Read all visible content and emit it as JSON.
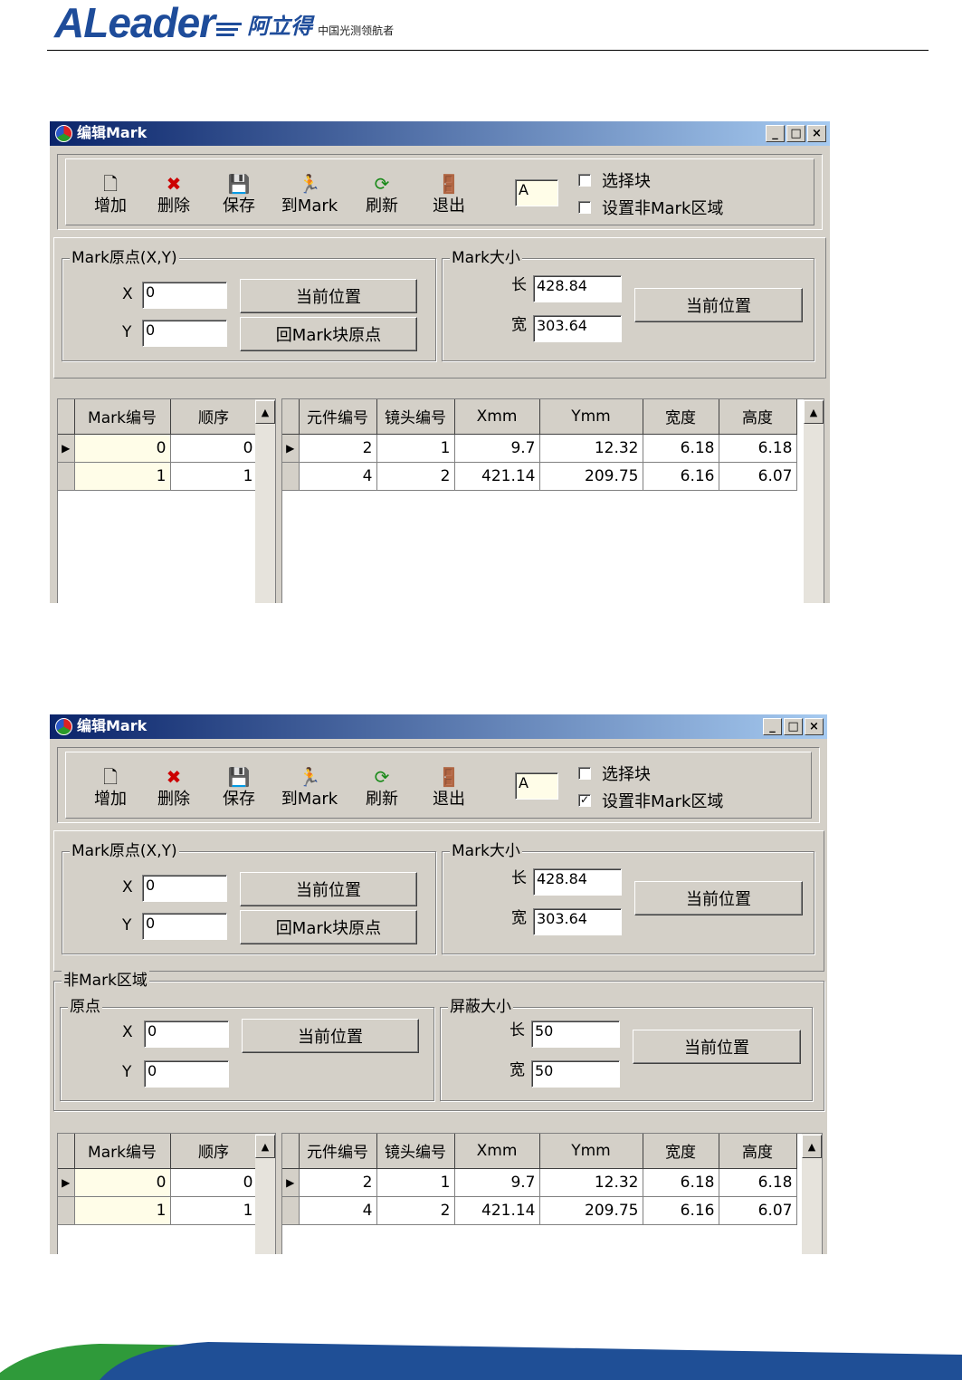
{
  "header": {
    "logo_text": "ALeader",
    "logo_cn": "阿立得",
    "slogan": "中国光测领航者"
  },
  "windows": [
    {
      "title": "编辑Mark",
      "title_buttons": [
        "_",
        "□",
        "×"
      ],
      "toolbar": {
        "tools": [
          {
            "label": "增加",
            "icon": "new-doc-icon"
          },
          {
            "label": "删除",
            "icon": "delete-icon"
          },
          {
            "label": "保存",
            "icon": "save-icon"
          },
          {
            "label": "到Mark",
            "icon": "run-man-icon"
          },
          {
            "label": "刷新",
            "icon": "refresh-icon"
          },
          {
            "label": "退出",
            "icon": "exit-door-icon"
          }
        ],
        "block_value": "A",
        "select_block": {
          "label": "选择块",
          "checked": false
        },
        "set_non_mark": {
          "label": "设置非Mark区域",
          "checked": false
        }
      },
      "mark_origin": {
        "title": "Mark原点(X,Y)",
        "x_label": "X",
        "x_value": "0",
        "y_label": "Y",
        "y_value": "0",
        "current_btn": "当前位置",
        "return_btn": "回Mark块原点"
      },
      "mark_size": {
        "title": "Mark大小",
        "len_label": "长",
        "len_value": "428.84",
        "wid_label": "宽",
        "wid_value": "303.64",
        "current_btn": "当前位置"
      },
      "mark_table": {
        "headers": [
          "Mark编号",
          "顺序"
        ],
        "rows": [
          [
            "0",
            "0"
          ],
          [
            "1",
            "1"
          ]
        ]
      },
      "part_table": {
        "headers": [
          "元件编号",
          "镜头编号",
          "Xmm",
          "Ymm",
          "宽度",
          "高度"
        ],
        "rows": [
          [
            "2",
            "1",
            "9.7",
            "12.32",
            "6.18",
            "6.18"
          ],
          [
            "4",
            "2",
            "421.14",
            "209.75",
            "6.16",
            "6.07"
          ]
        ]
      }
    },
    {
      "title": "编辑Mark",
      "title_buttons": [
        "_",
        "□",
        "×"
      ],
      "toolbar": {
        "tools": [
          {
            "label": "增加",
            "icon": "new-doc-icon"
          },
          {
            "label": "删除",
            "icon": "delete-icon"
          },
          {
            "label": "保存",
            "icon": "save-icon"
          },
          {
            "label": "到Mark",
            "icon": "run-man-icon"
          },
          {
            "label": "刷新",
            "icon": "refresh-icon"
          },
          {
            "label": "退出",
            "icon": "exit-door-icon"
          }
        ],
        "block_value": "A",
        "select_block": {
          "label": "选择块",
          "checked": false
        },
        "set_non_mark": {
          "label": "设置非Mark区域",
          "checked": true
        }
      },
      "mark_origin": {
        "title": "Mark原点(X,Y)",
        "x_label": "X",
        "x_value": "0",
        "y_label": "Y",
        "y_value": "0",
        "current_btn": "当前位置",
        "return_btn": "回Mark块原点"
      },
      "mark_size": {
        "title": "Mark大小",
        "len_label": "长",
        "len_value": "428.84",
        "wid_label": "宽",
        "wid_value": "303.64",
        "current_btn": "当前位置"
      },
      "non_mark": {
        "title": "非Mark区域",
        "origin_title": "原点",
        "x_label": "X",
        "x_value": "0",
        "y_label": "Y",
        "y_value": "0",
        "origin_btn": "当前位置",
        "shield_title": "屏蔽大小",
        "len_label": "长",
        "len_value": "50",
        "wid_label": "宽",
        "wid_value": "50",
        "shield_btn": "当前位置"
      },
      "mark_table": {
        "headers": [
          "Mark编号",
          "顺序"
        ],
        "rows": [
          [
            "0",
            "0"
          ],
          [
            "1",
            "1"
          ]
        ]
      },
      "part_table": {
        "headers": [
          "元件编号",
          "镜头编号",
          "Xmm",
          "Ymm",
          "宽度",
          "高度"
        ],
        "rows": [
          [
            "2",
            "1",
            "9.7",
            "12.32",
            "6.18",
            "6.18"
          ],
          [
            "4",
            "2",
            "421.14",
            "209.75",
            "6.16",
            "6.07"
          ]
        ]
      }
    }
  ]
}
